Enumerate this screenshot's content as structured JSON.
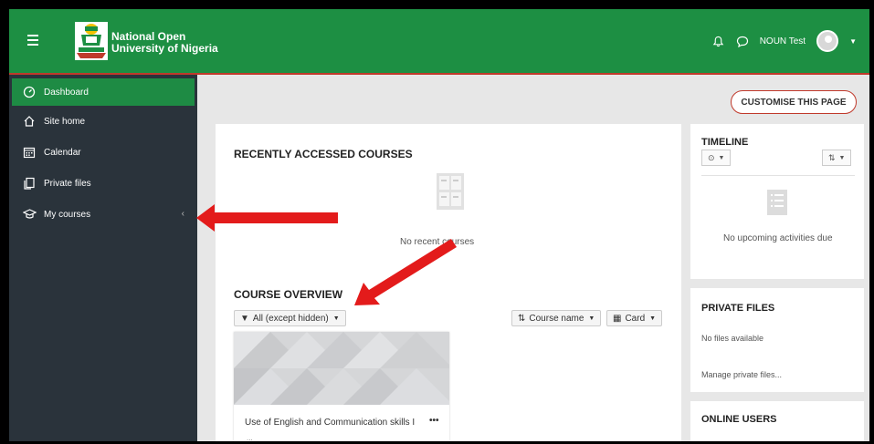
{
  "header": {
    "brand_line1": "National Open",
    "brand_line2": "University of Nigeria",
    "user_name": "NOUN Test"
  },
  "sidebar": {
    "items": [
      {
        "label": "Dashboard",
        "icon": "dashboard-icon",
        "active": true
      },
      {
        "label": "Site home",
        "icon": "home-icon"
      },
      {
        "label": "Calendar",
        "icon": "calendar-icon"
      },
      {
        "label": "Private files",
        "icon": "files-icon"
      },
      {
        "label": "My courses",
        "icon": "graduation-cap-icon"
      }
    ],
    "mycourses_chevron": "‹"
  },
  "main": {
    "customise_label": "CUSTOMISE THIS PAGE",
    "recent": {
      "title": "RECENTLY ACCESSED COURSES",
      "empty_text": "No recent courses"
    },
    "overview": {
      "title": "COURSE OVERVIEW",
      "filter_label": "All (except hidden)",
      "sort_label": "Course name",
      "view_label": "Card",
      "course_name": "Use of English and Communication skills I",
      "more_label": "•••",
      "course_ellipsis": "..."
    }
  },
  "blocks": {
    "timeline": {
      "title": "TIMELINE",
      "empty_text": "No upcoming activities due"
    },
    "private_files": {
      "title": "PRIVATE FILES",
      "empty_text": "No files available",
      "manage_link": "Manage private files..."
    },
    "online_users": {
      "title": "ONLINE USERS"
    }
  },
  "colors": {
    "brand_green": "#1d8f43",
    "sidebar_bg": "#2a333b",
    "accent_red": "#c0392b",
    "annotation_arrow": "#e31b1b"
  }
}
